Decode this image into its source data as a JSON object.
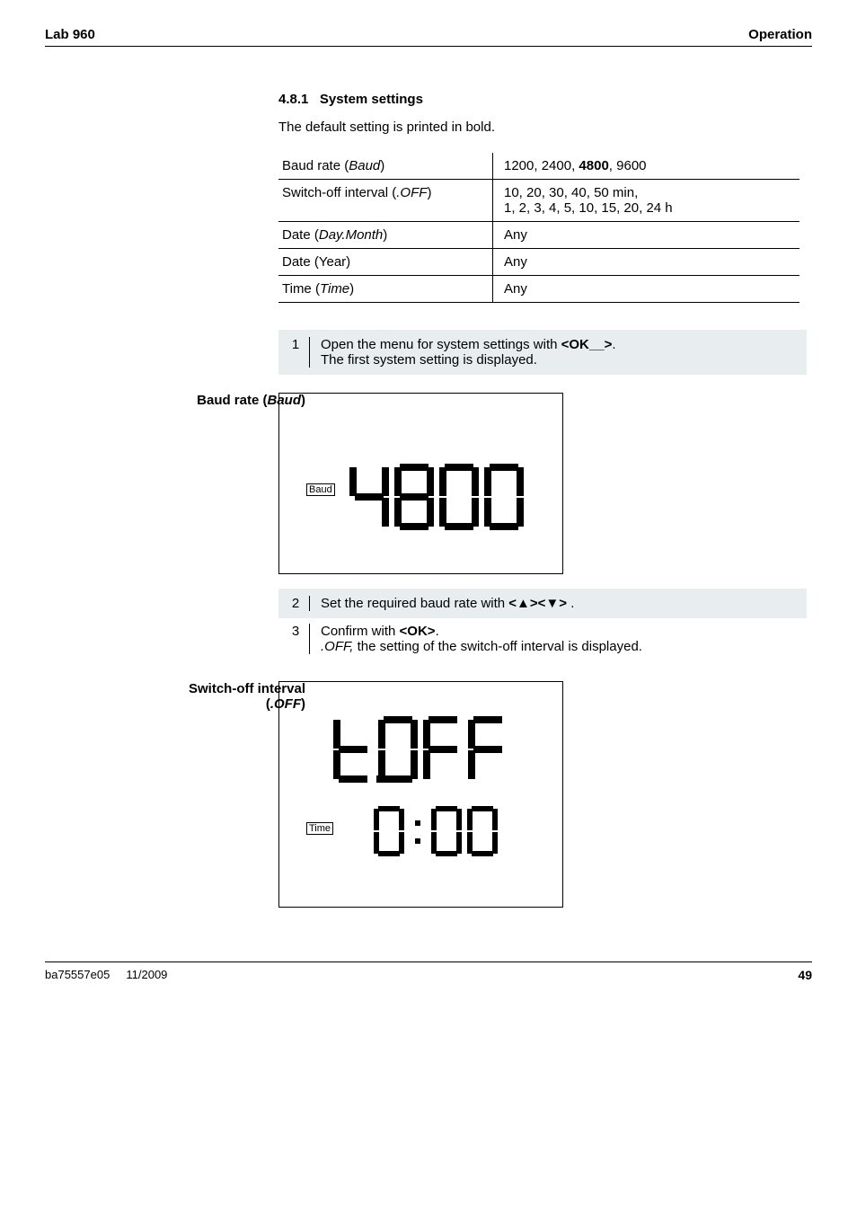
{
  "header": {
    "left": "Lab 960",
    "right": "Operation"
  },
  "section": {
    "number": "4.8.1",
    "title": "System settings",
    "intro": "The default setting is printed in bold."
  },
  "table": {
    "rows": [
      {
        "label_pre": "Baud rate (",
        "label_ital": "Baud",
        "label_post": ")",
        "val_pre": "1200, 2400, ",
        "val_bold": "4800",
        "val_post": ", 9600"
      },
      {
        "label_pre": "Switch-off interval (",
        "label_ital": ".OFF",
        "label_post": ")",
        "val_pre": "",
        "val_bold": "",
        "val_post": "10, 20, 30, 40, 50 min,\n1, 2, 3, 4, 5, 10, 15, 20, 24 h"
      },
      {
        "label_pre": "Date (",
        "label_ital": "Day.Month",
        "label_post": ")",
        "val_pre": "",
        "val_bold": "",
        "val_post": "Any"
      },
      {
        "label_pre": "Date (Year)",
        "label_ital": "",
        "label_post": "",
        "val_pre": "",
        "val_bold": "",
        "val_post": "Any"
      },
      {
        "label_pre": "Time (",
        "label_ital": "Time",
        "label_post": ")",
        "val_pre": "",
        "val_bold": "",
        "val_post": "Any"
      }
    ]
  },
  "steps": {
    "s1": {
      "num": "1",
      "text_pre": "Open the menu for system settings with ",
      "text_bold": "<OK__>",
      "text_post": ".\nThe first system setting is displayed."
    },
    "s2": {
      "num": "2",
      "text_pre": "Set the required baud rate with ",
      "text_bold": "<▲><▼>",
      "text_post": " ."
    },
    "s3": {
      "num": "3",
      "text_pre1": "Confirm with ",
      "text_bold1": "<OK>",
      "text_post1": ".",
      "text_ital2": ".OFF,",
      "text_post2": " the setting of the switch-off interval is displayed."
    }
  },
  "side_labels": {
    "baud_pre": "Baud rate  (",
    "baud_ital": "Baud",
    "baud_post": ")",
    "off_line1": "Switch-off interval",
    "off_pre": "(",
    "off_ital": ".OFF",
    "off_post": ")"
  },
  "lcd": {
    "baud_badge": "Baud",
    "time_badge": "Time"
  },
  "footer": {
    "left": "ba75557e05",
    "mid": "11/2009",
    "page": "49"
  }
}
